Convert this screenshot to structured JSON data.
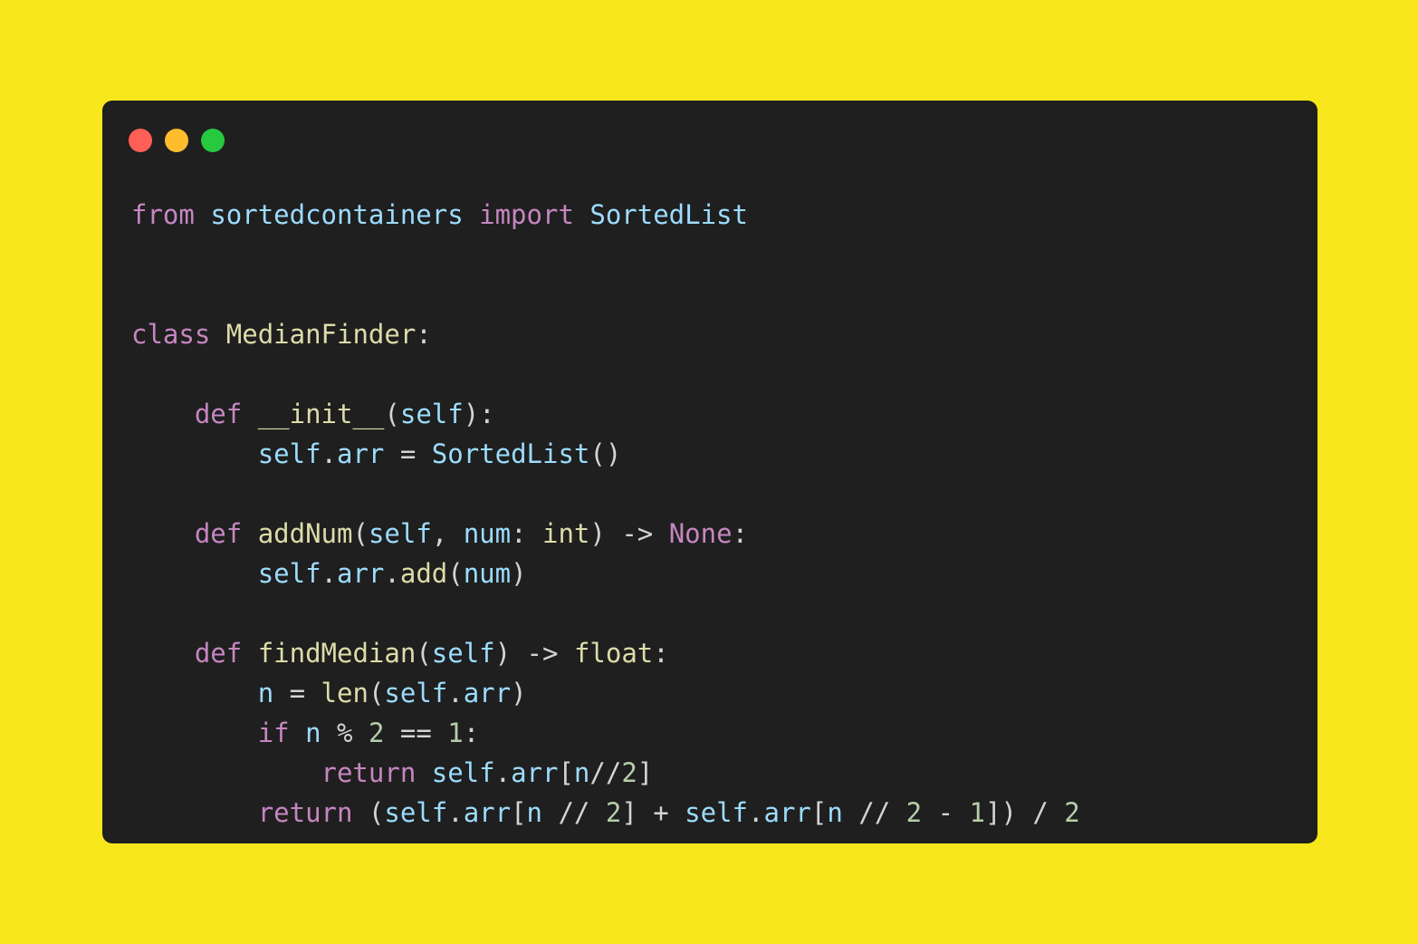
{
  "window": {
    "controls": [
      "close",
      "minimize",
      "zoom"
    ],
    "colors": {
      "close": "#ff5f56",
      "minimize": "#ffbd2e",
      "zoom": "#27c93f",
      "background": "#1f1f1f",
      "page_background": "#f8e71c"
    }
  },
  "code": {
    "language": "python",
    "lines": [
      [
        {
          "t": "from",
          "c": "kw"
        },
        {
          "t": " ",
          "c": "op"
        },
        {
          "t": "sortedcontainers",
          "c": "mod"
        },
        {
          "t": " ",
          "c": "op"
        },
        {
          "t": "import",
          "c": "kw"
        },
        {
          "t": " ",
          "c": "op"
        },
        {
          "t": "SortedList",
          "c": "cls"
        }
      ],
      [],
      [],
      [
        {
          "t": "class",
          "c": "kw"
        },
        {
          "t": " ",
          "c": "op"
        },
        {
          "t": "MedianFinder",
          "c": "name"
        },
        {
          "t": ":",
          "c": "punct"
        }
      ],
      [],
      [
        {
          "t": "    ",
          "c": "op"
        },
        {
          "t": "def",
          "c": "kw"
        },
        {
          "t": " ",
          "c": "op"
        },
        {
          "t": "__init__",
          "c": "fn"
        },
        {
          "t": "(",
          "c": "punct"
        },
        {
          "t": "self",
          "c": "self"
        },
        {
          "t": "):",
          "c": "punct"
        }
      ],
      [
        {
          "t": "        ",
          "c": "op"
        },
        {
          "t": "self",
          "c": "self"
        },
        {
          "t": ".",
          "c": "punct"
        },
        {
          "t": "arr",
          "c": "var"
        },
        {
          "t": " = ",
          "c": "op"
        },
        {
          "t": "SortedList",
          "c": "cls"
        },
        {
          "t": "()",
          "c": "punct"
        }
      ],
      [],
      [
        {
          "t": "    ",
          "c": "op"
        },
        {
          "t": "def",
          "c": "kw"
        },
        {
          "t": " ",
          "c": "op"
        },
        {
          "t": "addNum",
          "c": "fn"
        },
        {
          "t": "(",
          "c": "punct"
        },
        {
          "t": "self",
          "c": "self"
        },
        {
          "t": ", ",
          "c": "punct"
        },
        {
          "t": "num",
          "c": "var"
        },
        {
          "t": ": ",
          "c": "punct"
        },
        {
          "t": "int",
          "c": "builtin"
        },
        {
          "t": ") -> ",
          "c": "punct"
        },
        {
          "t": "None",
          "c": "const"
        },
        {
          "t": ":",
          "c": "punct"
        }
      ],
      [
        {
          "t": "        ",
          "c": "op"
        },
        {
          "t": "self",
          "c": "self"
        },
        {
          "t": ".",
          "c": "punct"
        },
        {
          "t": "arr",
          "c": "var"
        },
        {
          "t": ".",
          "c": "punct"
        },
        {
          "t": "add",
          "c": "fn"
        },
        {
          "t": "(",
          "c": "punct"
        },
        {
          "t": "num",
          "c": "var"
        },
        {
          "t": ")",
          "c": "punct"
        }
      ],
      [],
      [
        {
          "t": "    ",
          "c": "op"
        },
        {
          "t": "def",
          "c": "kw"
        },
        {
          "t": " ",
          "c": "op"
        },
        {
          "t": "findMedian",
          "c": "fn"
        },
        {
          "t": "(",
          "c": "punct"
        },
        {
          "t": "self",
          "c": "self"
        },
        {
          "t": ") -> ",
          "c": "punct"
        },
        {
          "t": "float",
          "c": "builtin"
        },
        {
          "t": ":",
          "c": "punct"
        }
      ],
      [
        {
          "t": "        ",
          "c": "op"
        },
        {
          "t": "n",
          "c": "var"
        },
        {
          "t": " = ",
          "c": "op"
        },
        {
          "t": "len",
          "c": "builtin"
        },
        {
          "t": "(",
          "c": "punct"
        },
        {
          "t": "self",
          "c": "self"
        },
        {
          "t": ".",
          "c": "punct"
        },
        {
          "t": "arr",
          "c": "var"
        },
        {
          "t": ")",
          "c": "punct"
        }
      ],
      [
        {
          "t": "        ",
          "c": "op"
        },
        {
          "t": "if",
          "c": "kw"
        },
        {
          "t": " ",
          "c": "op"
        },
        {
          "t": "n",
          "c": "var"
        },
        {
          "t": " % ",
          "c": "op"
        },
        {
          "t": "2",
          "c": "num"
        },
        {
          "t": " == ",
          "c": "op"
        },
        {
          "t": "1",
          "c": "num"
        },
        {
          "t": ":",
          "c": "punct"
        }
      ],
      [
        {
          "t": "            ",
          "c": "op"
        },
        {
          "t": "return",
          "c": "kw"
        },
        {
          "t": " ",
          "c": "op"
        },
        {
          "t": "self",
          "c": "self"
        },
        {
          "t": ".",
          "c": "punct"
        },
        {
          "t": "arr",
          "c": "var"
        },
        {
          "t": "[",
          "c": "punct"
        },
        {
          "t": "n",
          "c": "var"
        },
        {
          "t": "//",
          "c": "op"
        },
        {
          "t": "2",
          "c": "num"
        },
        {
          "t": "]",
          "c": "punct"
        }
      ],
      [
        {
          "t": "        ",
          "c": "op"
        },
        {
          "t": "return",
          "c": "kw"
        },
        {
          "t": " (",
          "c": "punct"
        },
        {
          "t": "self",
          "c": "self"
        },
        {
          "t": ".",
          "c": "punct"
        },
        {
          "t": "arr",
          "c": "var"
        },
        {
          "t": "[",
          "c": "punct"
        },
        {
          "t": "n",
          "c": "var"
        },
        {
          "t": " // ",
          "c": "op"
        },
        {
          "t": "2",
          "c": "num"
        },
        {
          "t": "] + ",
          "c": "punct"
        },
        {
          "t": "self",
          "c": "self"
        },
        {
          "t": ".",
          "c": "punct"
        },
        {
          "t": "arr",
          "c": "var"
        },
        {
          "t": "[",
          "c": "punct"
        },
        {
          "t": "n",
          "c": "var"
        },
        {
          "t": " // ",
          "c": "op"
        },
        {
          "t": "2",
          "c": "num"
        },
        {
          "t": " - ",
          "c": "op"
        },
        {
          "t": "1",
          "c": "num"
        },
        {
          "t": "]) / ",
          "c": "punct"
        },
        {
          "t": "2",
          "c": "num"
        }
      ]
    ]
  }
}
